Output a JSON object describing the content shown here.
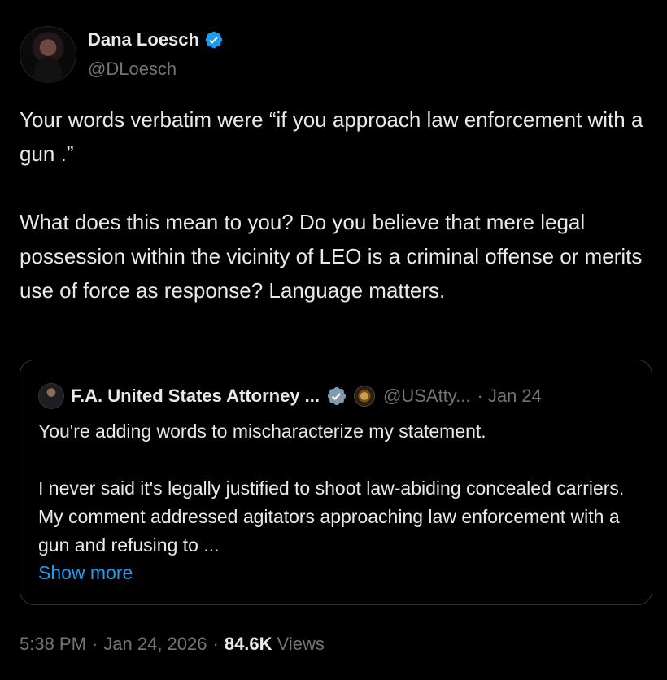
{
  "author": {
    "display_name": "Dana Loesch",
    "handle": "@DLoesch",
    "verified": true,
    "verified_color": "#1d9bf0"
  },
  "tweet": {
    "paragraphs": [
      "Your words verbatim were “if you approach law enforcement with a gun .”",
      "What does this mean to you? Do you believe that mere legal possession within the vicinity of LEO is a criminal offense or merits use of force as response? Language matters."
    ]
  },
  "quoted_tweet": {
    "display_name": "F.A. United States Attorney ...",
    "handle": "@USAtty...",
    "dot": "·",
    "date": "Jan 24",
    "verified": true,
    "verified_color": "#829aab",
    "paragraphs": [
      "You're adding words to mischaracterize my statement.",
      "I never said it's legally justified to shoot law-abiding concealed carriers. My comment addressed agitators approaching law enforcement with a gun and refusing to ..."
    ],
    "show_more_label": "Show more"
  },
  "meta": {
    "time": "5:38 PM",
    "separator": "·",
    "date": "Jan 24, 2026",
    "views_count": "84.6K",
    "views_label": "Views"
  },
  "colors": {
    "background": "#000000",
    "text_primary": "#e7e9ea",
    "text_secondary": "#71767b",
    "link": "#1d9bf0",
    "border": "#2f3336"
  }
}
